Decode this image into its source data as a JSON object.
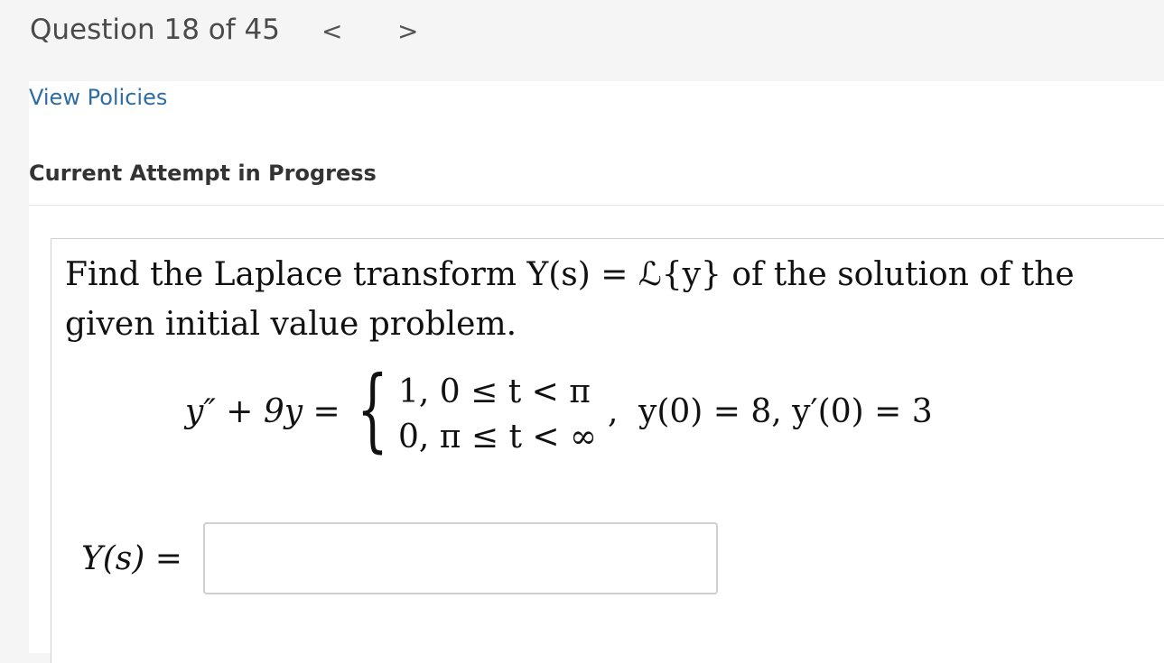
{
  "header": {
    "question_counter": "Question 18 of 45",
    "prev_glyph": "<",
    "next_glyph": ">"
  },
  "links": {
    "view_policies": "View Policies"
  },
  "status": {
    "attempt": "Current Attempt in Progress"
  },
  "question": {
    "prompt": "Find the Laplace transform Y(s) = ℒ{y} of the solution of the given initial value problem.",
    "equation": {
      "lhs": "y″ + 9y =",
      "case1": "1,  0 ≤ t < π",
      "case2": "0,  π ≤ t < ∞",
      "separator": ",",
      "initial_conditions": "y(0) = 8,  y′(0) = 3"
    },
    "answer": {
      "label": "Y(s) =",
      "value": "",
      "placeholder": ""
    }
  },
  "colors": {
    "link": "#2e6da4",
    "background": "#f5f5f5",
    "panel": "#ffffff",
    "input_border": "#cfcfcf"
  }
}
